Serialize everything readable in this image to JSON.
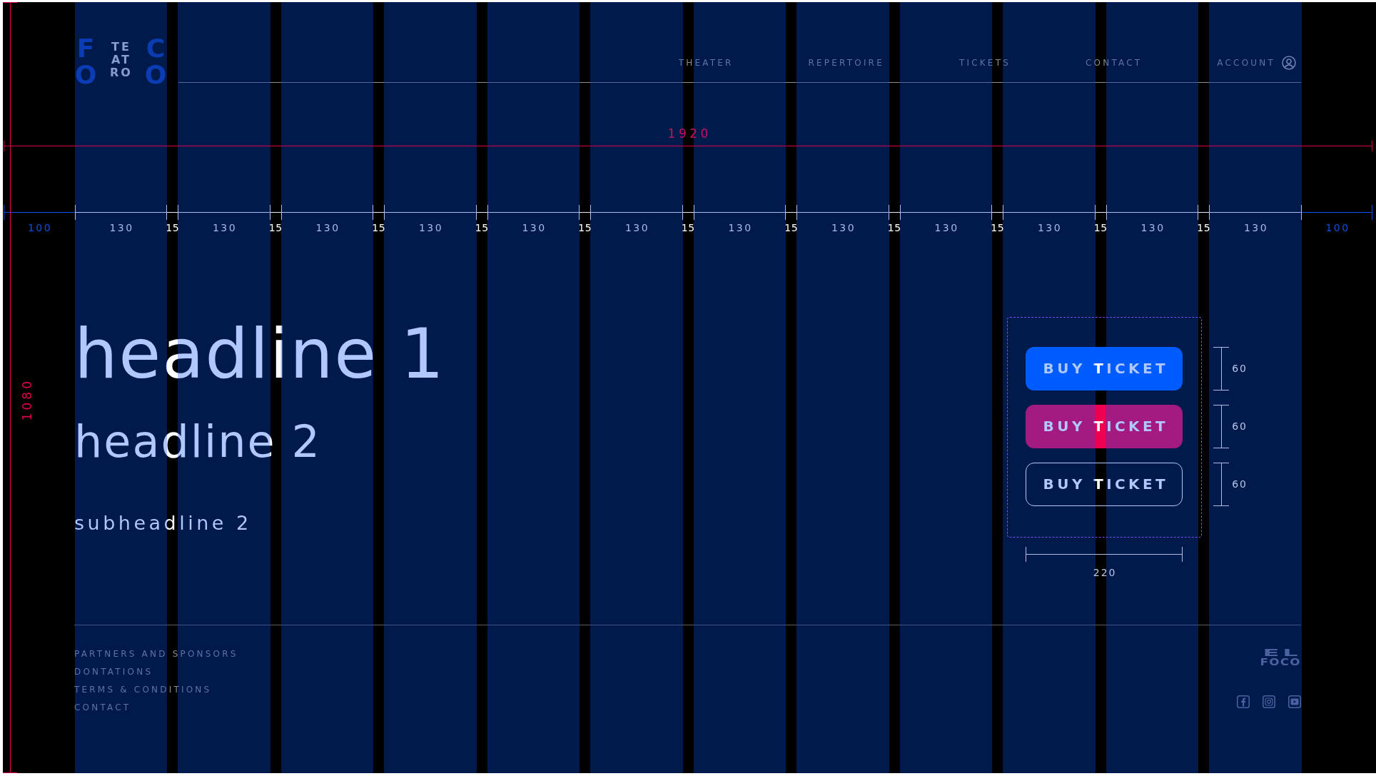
{
  "logo": {
    "left": [
      "F",
      "O"
    ],
    "middle": [
      "TE",
      "AT",
      "RO"
    ],
    "right": [
      "C",
      "O"
    ]
  },
  "nav": {
    "items": [
      {
        "label": "THEATER"
      },
      {
        "label": "REPERTOIRE"
      },
      {
        "label": "TICKETS"
      },
      {
        "label": "CONTACT"
      }
    ],
    "account": {
      "label": "ACCOUNT"
    }
  },
  "width_dimension": {
    "label": "1920"
  },
  "height_dimension": {
    "label": "1080"
  },
  "grid_ruler": [
    {
      "kind": "margin",
      "label": "100"
    },
    {
      "kind": "column",
      "label": "130"
    },
    {
      "kind": "gutter",
      "label": "15"
    },
    {
      "kind": "column",
      "label": "130"
    },
    {
      "kind": "gutter",
      "label": "15"
    },
    {
      "kind": "column",
      "label": "130"
    },
    {
      "kind": "gutter",
      "label": "15"
    },
    {
      "kind": "column",
      "label": "130"
    },
    {
      "kind": "gutter",
      "label": "15"
    },
    {
      "kind": "column",
      "label": "130"
    },
    {
      "kind": "gutter",
      "label": "15"
    },
    {
      "kind": "column",
      "label": "130"
    },
    {
      "kind": "gutter",
      "label": "15"
    },
    {
      "kind": "column",
      "label": "130"
    },
    {
      "kind": "gutter",
      "label": "15"
    },
    {
      "kind": "column",
      "label": "130"
    },
    {
      "kind": "gutter",
      "label": "15"
    },
    {
      "kind": "column",
      "label": "130"
    },
    {
      "kind": "gutter",
      "label": "15"
    },
    {
      "kind": "column",
      "label": "130"
    },
    {
      "kind": "gutter",
      "label": "15"
    },
    {
      "kind": "column",
      "label": "130"
    },
    {
      "kind": "gutter",
      "label": "15"
    },
    {
      "kind": "column",
      "label": "130"
    },
    {
      "kind": "margin",
      "label": "100"
    }
  ],
  "typography": [
    {
      "kind": "headline_1",
      "text": "headline 1"
    },
    {
      "kind": "headline_2",
      "text": "headline 2"
    },
    {
      "kind": "subheadline_2",
      "text": "subheadline 2"
    }
  ],
  "buttons": {
    "items": [
      {
        "kind": "primary",
        "label": "BUY TICKET",
        "height_label": "60"
      },
      {
        "kind": "secondary",
        "label": "BUY TICKET",
        "height_label": "60"
      },
      {
        "kind": "outline",
        "label": "BUY TICKET",
        "height_label": "60"
      }
    ],
    "width_label": "220"
  },
  "footer": {
    "links": [
      "PARTNERS AND SPONSORS",
      "DONTATIONS",
      "TERMS & CONDITIONS",
      "CONTACT"
    ],
    "brand": [
      "EL",
      "FOCO"
    ]
  }
}
